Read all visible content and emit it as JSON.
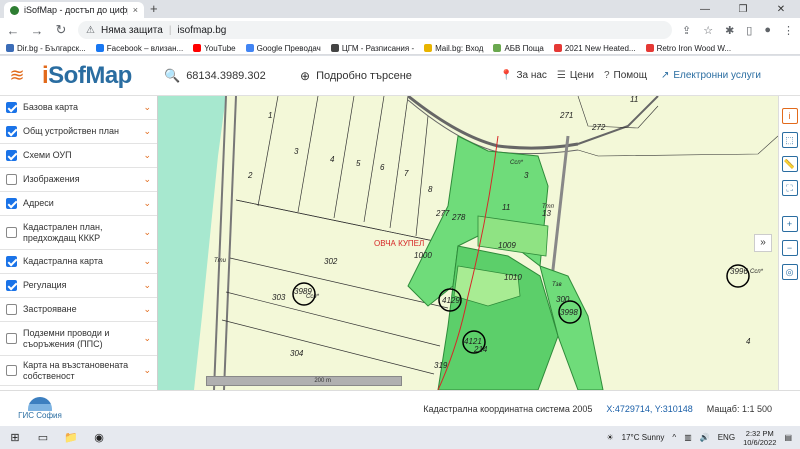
{
  "browser": {
    "tab_title": "iSofMap - достъп до цифрови д",
    "tab_close": "×",
    "new_tab": "+",
    "security_label": "Няма защита",
    "url": "isofmap.bg",
    "bookmarks": [
      {
        "label": "Dir.bg - Българск...",
        "color": "#3b6cb7"
      },
      {
        "label": "Facebook – влизан...",
        "color": "#1877f2"
      },
      {
        "label": "YouTube",
        "color": "#ff0000"
      },
      {
        "label": "Google Преводач",
        "color": "#4285f4"
      },
      {
        "label": "ЦГМ - Разписания -",
        "color": "#444444"
      },
      {
        "label": "Mail.bg: Вход",
        "color": "#e8b400"
      },
      {
        "label": "АБВ Поща",
        "color": "#6aa84f"
      },
      {
        "label": "2021 New Heated...",
        "color": "#e53935"
      },
      {
        "label": "Retro Iron Wood W...",
        "color": "#e53935"
      }
    ]
  },
  "header": {
    "logo_prefix": "i",
    "logo_main": "SofMap",
    "search_value": "68134.3989.302",
    "advanced_search": "Подробно търсене",
    "menu": [
      {
        "icon": "📍",
        "label": "За нас"
      },
      {
        "icon": "☰",
        "label": "Цени"
      },
      {
        "icon": "?",
        "label": "Помощ"
      }
    ],
    "eservices": "Електронни услуги"
  },
  "layers": [
    {
      "label": "Базова карта",
      "checked": true
    },
    {
      "label": "Общ устройствен план",
      "checked": true
    },
    {
      "label": "Схеми ОУП",
      "checked": true
    },
    {
      "label": "Изображения",
      "checked": false
    },
    {
      "label": "Адреси",
      "checked": true
    },
    {
      "label": "Кадастрален план, предхождащ КККР",
      "checked": false
    },
    {
      "label": "Кадастрална карта",
      "checked": true
    },
    {
      "label": "Регулация",
      "checked": true
    },
    {
      "label": "Застрояване",
      "checked": false
    },
    {
      "label": "Подземни проводи и съоръжения (ППС)",
      "checked": false
    },
    {
      "label": "Карта на възстановената собственост",
      "checked": false
    }
  ],
  "map": {
    "parcel_labels": [
      "1",
      "2",
      "3",
      "4",
      "5",
      "6",
      "7",
      "8",
      "11",
      "271",
      "272",
      "3",
      "11",
      "13",
      "277",
      "278",
      "1009",
      "1010",
      "1000",
      "302",
      "303",
      "304",
      "300",
      "4",
      "319",
      "4121",
      "214",
      "4129",
      "3996",
      "3998",
      "3989"
    ],
    "area_labels": [
      "Ссп*",
      "Ттп",
      "Тти",
      "Тзв",
      "Ссп*",
      "Ссп*"
    ],
    "place_name": "ОВЧА КУПЕЛ",
    "scale_text": "200 m",
    "expand_icon": "»"
  },
  "footer": {
    "gis_name": "ГИС София",
    "coord_system": "Кадастрална координатна система 2005",
    "xy": "X:4729714, Y:310148",
    "scale": "Мащаб: 1:1 500"
  },
  "taskbar": {
    "weather": "17°C  Sunny",
    "lang": "ENG",
    "time": "2:32 PM",
    "date": "10/6/2022"
  }
}
